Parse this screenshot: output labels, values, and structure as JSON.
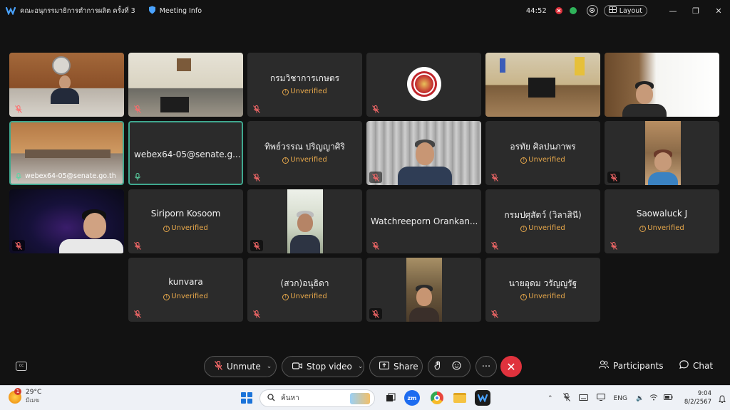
{
  "titlebar": {
    "title": "คณะอนุกรรมาธิการตำการผลิต ครั้งที่ 3",
    "meeting_info": "Meeting Info",
    "timer": "44:52",
    "layout_label": "Layout"
  },
  "tiles": {
    "t1": {
      "name": ""
    },
    "t2": {
      "name": ""
    },
    "t3": {
      "name": "กรมวิชาการเกษตร",
      "status": "Unverified"
    },
    "t4": {
      "name": ""
    },
    "t5": {
      "name": ""
    },
    "t6": {
      "name": ""
    },
    "t7": {
      "label": "webex64-05@senate.go.th"
    },
    "t8": {
      "name": "webex64-05@senate.g..."
    },
    "t9": {
      "name": "ทิพย์วรรณ ปริญญาศิริ",
      "status": "Unverified"
    },
    "t10": {
      "name": ""
    },
    "t11": {
      "name": "อรทัย ศิลปนภาพร",
      "status": "Unverified"
    },
    "t12": {
      "name": ""
    },
    "t13": {
      "name": ""
    },
    "t14": {
      "name": "Siriporn Kosoom",
      "status": "Unverified"
    },
    "t15": {
      "name": ""
    },
    "t16": {
      "name": "Watchreeporn Orankan..."
    },
    "t17": {
      "name": "กรมปศุสัตว์ (วิลาสินี)",
      "status": "Unverified"
    },
    "t18": {
      "name": "Saowaluck J",
      "status": "Unverified"
    },
    "t19": {
      "name": "kunvara",
      "status": "Unverified"
    },
    "t20": {
      "name": "(สวก)อนุธิดา",
      "status": "Unverified"
    },
    "t21": {
      "name": ""
    },
    "t22": {
      "name": "นายอุดม วรัญญูรัฐ",
      "status": "Unverified"
    }
  },
  "controls": {
    "unmute": "Unmute",
    "stop_video": "Stop video",
    "share": "Share",
    "more": "···",
    "participants": "Participants",
    "chat": "Chat",
    "cc": "cc"
  },
  "taskbar": {
    "weather_badge": "1",
    "temp": "29°C",
    "weather_text": "มีเมฆ",
    "search_placeholder": "ค้นหา",
    "zoom_app": "zm",
    "lang": "ENG",
    "time": "9:04",
    "date": "8/2/2567"
  },
  "colors": {
    "accent_green": "#3fa88f",
    "unverified": "#e7a84b",
    "end_call": "#e0323d"
  }
}
